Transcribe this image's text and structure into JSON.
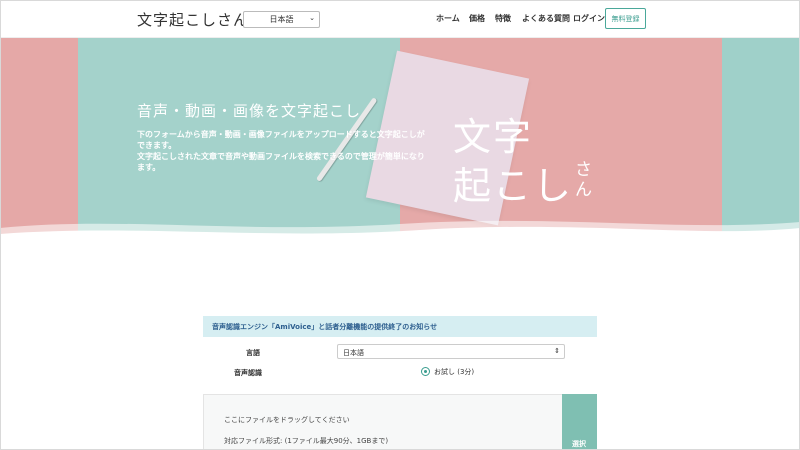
{
  "header": {
    "logo": "文字起こしさん",
    "language_select": "日本語",
    "nav": [
      {
        "label": "ホーム"
      },
      {
        "label": "価格"
      },
      {
        "label": "特徴"
      },
      {
        "label": "よくある質問"
      },
      {
        "label": "ログイン"
      }
    ],
    "signup_label": "無料登録"
  },
  "hero": {
    "title": "音声・動画・画像を文字起こし",
    "desc_line1": "下のフォームから音声・動画・画像ファイルをアップロードすると文字起こしが",
    "desc_line2": "できます。",
    "desc_line3": "文字起こしされた文章で音声や動画ファイルを検索できるので管理が簡単になり",
    "desc_line4": "ます。",
    "logo_line1": "文字",
    "logo_line2": "起こし",
    "logo_sa": "さ",
    "logo_n": "ん"
  },
  "notice": "音声認識エンジン「AmiVoice」と話者分離機能の提供終了のお知らせ",
  "form": {
    "language_label": "言語",
    "language_value": "日本語",
    "recognition_label": "音声認識",
    "recognition_option": "お試し (3分)"
  },
  "dropzone": {
    "drag_text": "ここにファイルをドラッグしてください",
    "formats_text": "対応ファイル形式: (1ファイル最大90分、1GBまで)",
    "side_text": "選択"
  },
  "colors": {
    "teal_stripe": "#9fd0c9",
    "pink_stripe": "#e5a8a7",
    "accent": "#3a9d8f",
    "notice_bg": "#d6eef2"
  }
}
